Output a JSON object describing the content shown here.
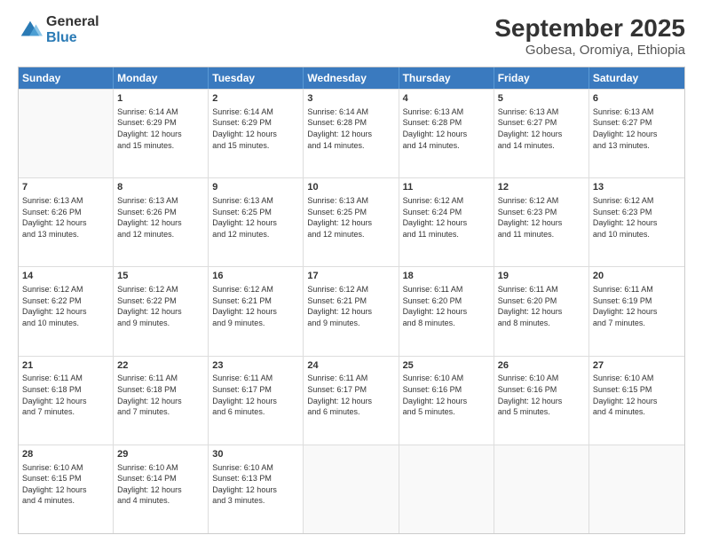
{
  "logo": {
    "line1": "General",
    "line2": "Blue"
  },
  "title": "September 2025",
  "location": "Gobesa, Oromiya, Ethiopia",
  "days": [
    "Sunday",
    "Monday",
    "Tuesday",
    "Wednesday",
    "Thursday",
    "Friday",
    "Saturday"
  ],
  "weeks": [
    [
      {
        "num": "",
        "info": ""
      },
      {
        "num": "1",
        "info": "Sunrise: 6:14 AM\nSunset: 6:29 PM\nDaylight: 12 hours\nand 15 minutes."
      },
      {
        "num": "2",
        "info": "Sunrise: 6:14 AM\nSunset: 6:29 PM\nDaylight: 12 hours\nand 15 minutes."
      },
      {
        "num": "3",
        "info": "Sunrise: 6:14 AM\nSunset: 6:28 PM\nDaylight: 12 hours\nand 14 minutes."
      },
      {
        "num": "4",
        "info": "Sunrise: 6:13 AM\nSunset: 6:28 PM\nDaylight: 12 hours\nand 14 minutes."
      },
      {
        "num": "5",
        "info": "Sunrise: 6:13 AM\nSunset: 6:27 PM\nDaylight: 12 hours\nand 14 minutes."
      },
      {
        "num": "6",
        "info": "Sunrise: 6:13 AM\nSunset: 6:27 PM\nDaylight: 12 hours\nand 13 minutes."
      }
    ],
    [
      {
        "num": "7",
        "info": "Sunrise: 6:13 AM\nSunset: 6:26 PM\nDaylight: 12 hours\nand 13 minutes."
      },
      {
        "num": "8",
        "info": "Sunrise: 6:13 AM\nSunset: 6:26 PM\nDaylight: 12 hours\nand 12 minutes."
      },
      {
        "num": "9",
        "info": "Sunrise: 6:13 AM\nSunset: 6:25 PM\nDaylight: 12 hours\nand 12 minutes."
      },
      {
        "num": "10",
        "info": "Sunrise: 6:13 AM\nSunset: 6:25 PM\nDaylight: 12 hours\nand 12 minutes."
      },
      {
        "num": "11",
        "info": "Sunrise: 6:12 AM\nSunset: 6:24 PM\nDaylight: 12 hours\nand 11 minutes."
      },
      {
        "num": "12",
        "info": "Sunrise: 6:12 AM\nSunset: 6:23 PM\nDaylight: 12 hours\nand 11 minutes."
      },
      {
        "num": "13",
        "info": "Sunrise: 6:12 AM\nSunset: 6:23 PM\nDaylight: 12 hours\nand 10 minutes."
      }
    ],
    [
      {
        "num": "14",
        "info": "Sunrise: 6:12 AM\nSunset: 6:22 PM\nDaylight: 12 hours\nand 10 minutes."
      },
      {
        "num": "15",
        "info": "Sunrise: 6:12 AM\nSunset: 6:22 PM\nDaylight: 12 hours\nand 9 minutes."
      },
      {
        "num": "16",
        "info": "Sunrise: 6:12 AM\nSunset: 6:21 PM\nDaylight: 12 hours\nand 9 minutes."
      },
      {
        "num": "17",
        "info": "Sunrise: 6:12 AM\nSunset: 6:21 PM\nDaylight: 12 hours\nand 9 minutes."
      },
      {
        "num": "18",
        "info": "Sunrise: 6:11 AM\nSunset: 6:20 PM\nDaylight: 12 hours\nand 8 minutes."
      },
      {
        "num": "19",
        "info": "Sunrise: 6:11 AM\nSunset: 6:20 PM\nDaylight: 12 hours\nand 8 minutes."
      },
      {
        "num": "20",
        "info": "Sunrise: 6:11 AM\nSunset: 6:19 PM\nDaylight: 12 hours\nand 7 minutes."
      }
    ],
    [
      {
        "num": "21",
        "info": "Sunrise: 6:11 AM\nSunset: 6:18 PM\nDaylight: 12 hours\nand 7 minutes."
      },
      {
        "num": "22",
        "info": "Sunrise: 6:11 AM\nSunset: 6:18 PM\nDaylight: 12 hours\nand 7 minutes."
      },
      {
        "num": "23",
        "info": "Sunrise: 6:11 AM\nSunset: 6:17 PM\nDaylight: 12 hours\nand 6 minutes."
      },
      {
        "num": "24",
        "info": "Sunrise: 6:11 AM\nSunset: 6:17 PM\nDaylight: 12 hours\nand 6 minutes."
      },
      {
        "num": "25",
        "info": "Sunrise: 6:10 AM\nSunset: 6:16 PM\nDaylight: 12 hours\nand 5 minutes."
      },
      {
        "num": "26",
        "info": "Sunrise: 6:10 AM\nSunset: 6:16 PM\nDaylight: 12 hours\nand 5 minutes."
      },
      {
        "num": "27",
        "info": "Sunrise: 6:10 AM\nSunset: 6:15 PM\nDaylight: 12 hours\nand 4 minutes."
      }
    ],
    [
      {
        "num": "28",
        "info": "Sunrise: 6:10 AM\nSunset: 6:15 PM\nDaylight: 12 hours\nand 4 minutes."
      },
      {
        "num": "29",
        "info": "Sunrise: 6:10 AM\nSunset: 6:14 PM\nDaylight: 12 hours\nand 4 minutes."
      },
      {
        "num": "30",
        "info": "Sunrise: 6:10 AM\nSunset: 6:13 PM\nDaylight: 12 hours\nand 3 minutes."
      },
      {
        "num": "",
        "info": ""
      },
      {
        "num": "",
        "info": ""
      },
      {
        "num": "",
        "info": ""
      },
      {
        "num": "",
        "info": ""
      }
    ]
  ]
}
